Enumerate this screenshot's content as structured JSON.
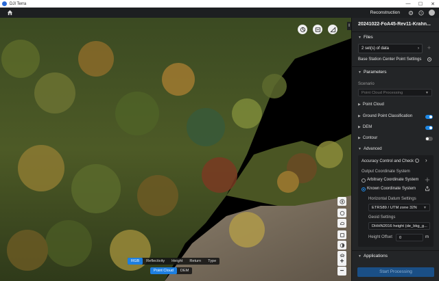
{
  "window": {
    "app_title": "DJI Terra",
    "min": "—",
    "max": "☐",
    "close": "✕"
  },
  "topnav": {
    "mode": "Reconstruction"
  },
  "viewport": {
    "display_modes": [
      "RGB",
      "Reflectivity",
      "Height",
      "Return",
      "Type"
    ],
    "active_display_mode": "RGB",
    "layers": [
      "Point Cloud",
      "DEM"
    ],
    "active_layer": "Point Cloud",
    "zoom_in": "+",
    "zoom_out": "−"
  },
  "panel": {
    "project_title": "20241022-FoA45-Rev11-Krahn...",
    "files": {
      "heading": "Files",
      "dataset_label": "2 set(s) of data",
      "add": "+",
      "base_station": "Base Station Center Point Settings"
    },
    "parameters": {
      "heading": "Parameters",
      "scenario_label": "Scenario",
      "scenario_value": "Point Cloud Processing",
      "point_cloud": "Point Cloud",
      "ground_classification": "Ground Point Classification",
      "ground_classification_on": true,
      "dem": "DEM",
      "dem_on": true,
      "contour": "Contour",
      "contour_on": false,
      "advanced": "Advanced",
      "accuracy": "Accuracy Control and Check",
      "output_coord": "Output Coordinate System",
      "arbitrary": "Arbitrary Coordinate System",
      "known": "Known Coordinate System",
      "horizontal_datum": "Horizontal Datum Settings",
      "horizontal_value": "ETRS89 / UTM zone 32N",
      "geoid": "Geoid Settings",
      "geoid_value": "DHHN2016 height (de_bkg_g...",
      "height_offset_label": "Height Offset",
      "height_offset_value": "0",
      "height_unit": "m"
    },
    "applications": {
      "heading": "Applications"
    },
    "start_button": "Start Processing"
  }
}
